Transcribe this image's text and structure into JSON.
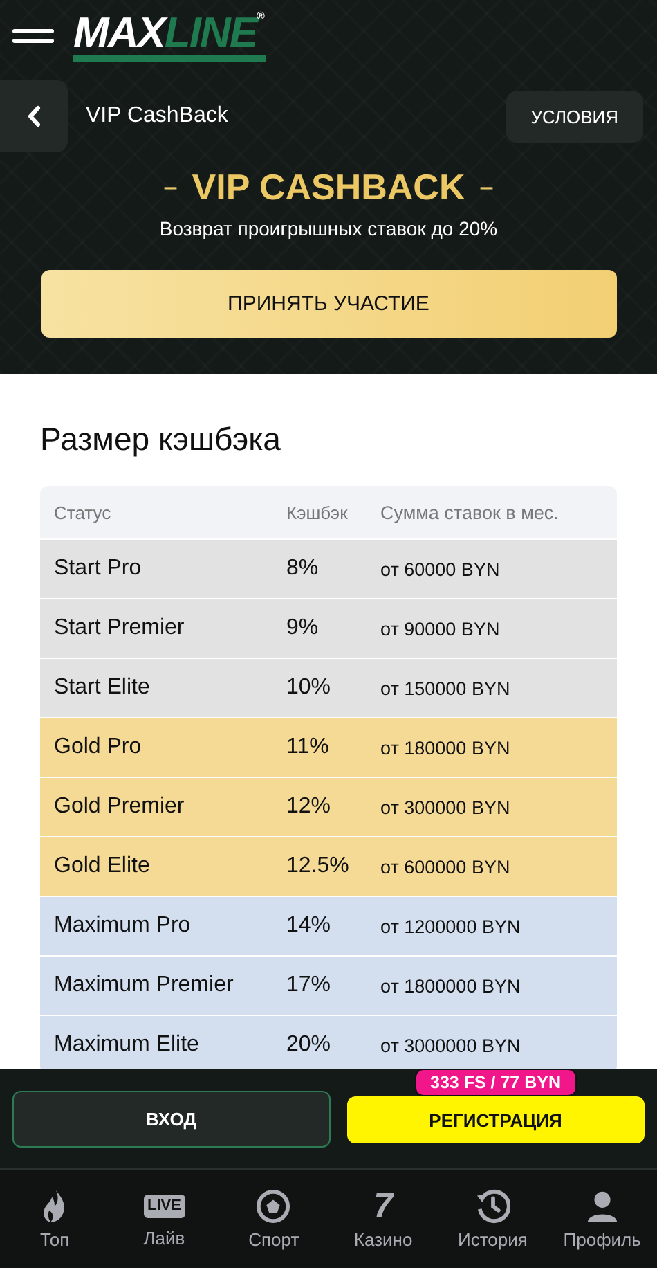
{
  "header": {
    "logo": {
      "part_1": "MAX",
      "part_2": "LINE",
      "mark": "®"
    }
  },
  "subheader": {
    "title": "VIP CashBack",
    "conditions_button": "УСЛОВИЯ"
  },
  "hero": {
    "dash_left": "–",
    "title": "VIP CASHBACK",
    "dash_right": "–",
    "subtitle": "Возврат проигрышных ставок до 20%",
    "button": "ПРИНЯТЬ УЧАСТИЕ"
  },
  "section_title": "Размер кэшбэка",
  "table": {
    "columns": [
      "Статус",
      "Кэшбэк",
      "Сумма ставок в мес."
    ],
    "rows": [
      {
        "color": "#e2e2e2",
        "status": "Start Pro",
        "cashback": "8%",
        "amount": "от 60000 BYN"
      },
      {
        "color": "#e2e2e2",
        "status": "Start Premier",
        "cashback": "9%",
        "amount": "от 90000 BYN"
      },
      {
        "color": "#e2e2e2",
        "status": "Start Elite",
        "cashback": "10%",
        "amount": "от 150000 BYN"
      },
      {
        "color": "#f5da96",
        "status": "Gold Pro",
        "cashback": "11%",
        "amount": "от 180000 BYN"
      },
      {
        "color": "#f5da96",
        "status": "Gold Premier",
        "cashback": "12%",
        "amount": "от 300000 BYN"
      },
      {
        "color": "#f5da96",
        "status": "Gold Elite",
        "cashback": "12.5%",
        "amount": "от 600000 BYN"
      },
      {
        "color": "#d3dfef",
        "status": "Maximum Pro",
        "cashback": "14%",
        "amount": "от 1200000 BYN"
      },
      {
        "color": "#d3dfef",
        "status": "Maximum Premier",
        "cashback": "17%",
        "amount": "от 1800000 BYN"
      },
      {
        "color": "#d3dfef",
        "status": "Maximum Elite",
        "cashback": "20%",
        "amount": "от 3000000 BYN"
      }
    ]
  },
  "auth": {
    "login": "ВХОД",
    "register": "РЕГИСТРАЦИЯ",
    "bonus_badge": "333 FS / 77 BYN"
  },
  "nav": [
    {
      "kind": "top",
      "label": "Топ"
    },
    {
      "kind": "live",
      "label": "Лайв",
      "icon_text": "LIVE"
    },
    {
      "kind": "sport",
      "label": "Спорт"
    },
    {
      "kind": "casino",
      "label": "Казино",
      "icon_text": "7"
    },
    {
      "kind": "history",
      "label": "История"
    },
    {
      "kind": "profile",
      "label": "Профиль"
    }
  ]
}
